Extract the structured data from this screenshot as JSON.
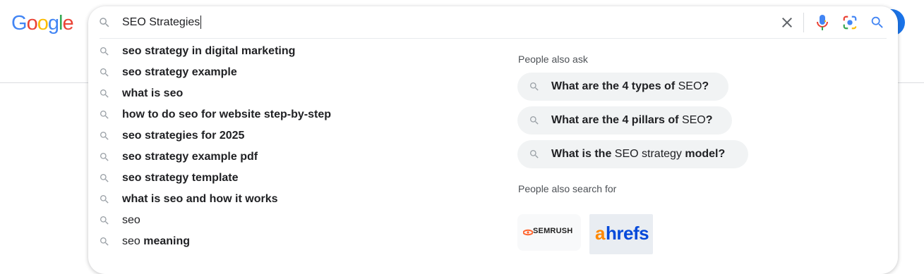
{
  "logo": {
    "letters": [
      {
        "char": "G",
        "color": "#4285F4"
      },
      {
        "char": "o",
        "color": "#EA4335"
      },
      {
        "char": "o",
        "color": "#FBBC05"
      },
      {
        "char": "g",
        "color": "#4285F4"
      },
      {
        "char": "l",
        "color": "#34A853"
      },
      {
        "char": "e",
        "color": "#EA4335"
      }
    ]
  },
  "search": {
    "query": "SEO Strategies"
  },
  "toolbar": {
    "clear_icon": "close-icon",
    "voice_icon": "microphone-icon",
    "lens_icon": "camera-lens-icon",
    "search_icon": "search-icon"
  },
  "suggestions": [
    {
      "parts": [
        {
          "t": "seo strategy in digital marketing",
          "b": true
        }
      ]
    },
    {
      "parts": [
        {
          "t": "seo strategy example",
          "b": true
        }
      ]
    },
    {
      "parts": [
        {
          "t": "what is seo",
          "b": true
        }
      ]
    },
    {
      "parts": [
        {
          "t": "how to do seo for website step-by-step",
          "b": true
        }
      ]
    },
    {
      "parts": [
        {
          "t": "seo strategies for 2025",
          "b": true
        }
      ]
    },
    {
      "parts": [
        {
          "t": "seo strategy example pdf",
          "b": true
        }
      ]
    },
    {
      "parts": [
        {
          "t": "seo strategy template",
          "b": true
        }
      ]
    },
    {
      "parts": [
        {
          "t": "what is seo and how it works",
          "b": true
        }
      ]
    },
    {
      "parts": [
        {
          "t": "seo",
          "b": false
        }
      ]
    },
    {
      "parts": [
        {
          "t": "seo ",
          "b": false
        },
        {
          "t": "meaning",
          "b": true
        }
      ]
    }
  ],
  "people_also_ask": {
    "label": "People also ask",
    "questions": [
      {
        "parts": [
          {
            "t": "What are the 4 types of ",
            "b": true
          },
          {
            "t": "SEO",
            "b": false
          },
          {
            "t": "?",
            "b": true
          }
        ]
      },
      {
        "parts": [
          {
            "t": "What are the 4 pillars of ",
            "b": true
          },
          {
            "t": "SEO",
            "b": false
          },
          {
            "t": "?",
            "b": true
          }
        ]
      },
      {
        "parts": [
          {
            "t": "What is the ",
            "b": true
          },
          {
            "t": "SEO strategy",
            "b": false
          },
          {
            "t": " model?",
            "b": true
          }
        ]
      }
    ]
  },
  "people_also_search": {
    "label": "People also search for",
    "brands": [
      {
        "name": "SEMRUSH",
        "accent": "#ff642d"
      },
      {
        "name_a": "a",
        "name_rest": "hrefs",
        "accent": "#ff8800",
        "primary": "#054ada"
      }
    ]
  },
  "colors": {
    "accent_blue": "#1a73e8",
    "chip_bg": "#f1f3f4",
    "icon_grey": "#9aa0a6"
  }
}
